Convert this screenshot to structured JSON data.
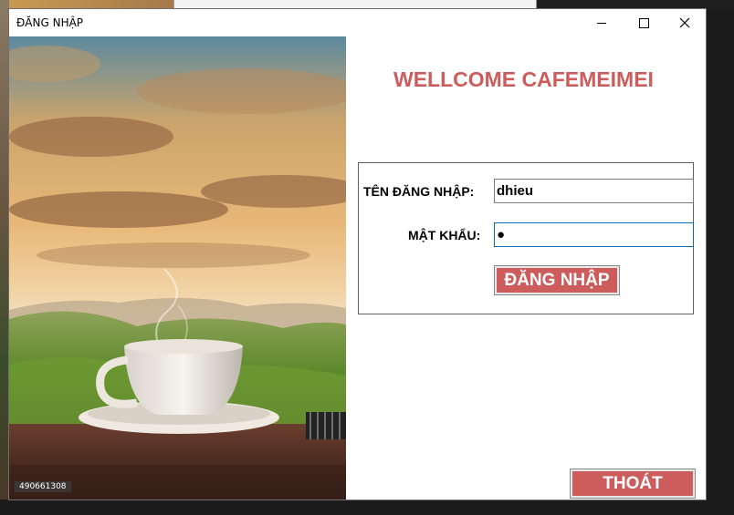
{
  "window": {
    "title": "ĐĂNG NHẬP",
    "controls": [
      "minimize-icon",
      "maximize-icon",
      "close-icon"
    ]
  },
  "photo": {
    "label": "490661308"
  },
  "welcome_text": "WELLCOME CAFEMEIMEI",
  "login": {
    "username_label": "TÊN ĐĂNG NHẬP:",
    "username_value": "dhieu",
    "password_label": "MẬT KHẨU:",
    "password_value": "●",
    "login_button": "ĐĂNG NHẬP"
  },
  "exit_button": "THOÁT",
  "colors": {
    "accent": "#cd5c5c",
    "window_bg": "#ffffff",
    "focus_border": "#0a6ebd"
  }
}
